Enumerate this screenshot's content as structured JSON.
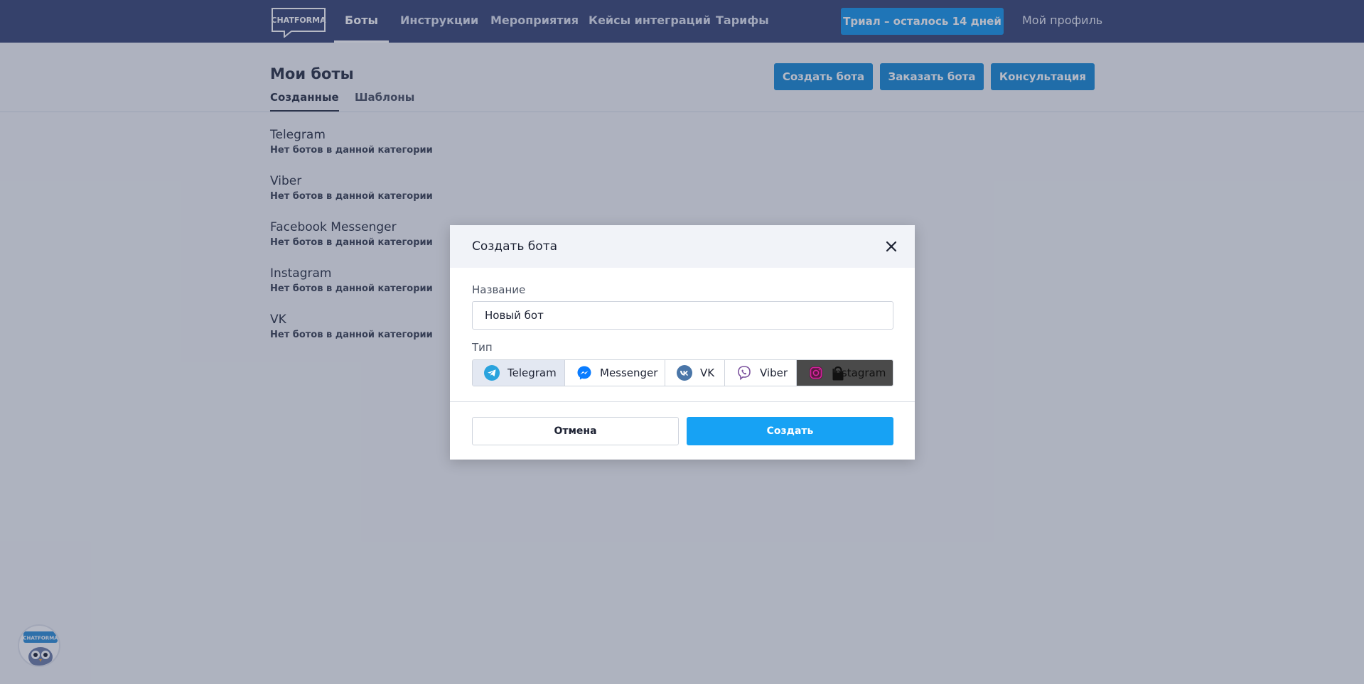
{
  "header": {
    "logo_text": "CHATFORMA",
    "nav": [
      {
        "label": "Боты",
        "active": true
      },
      {
        "label": "Инструкции"
      },
      {
        "label": "Мероприятия"
      },
      {
        "label": "Кейсы интеграций"
      },
      {
        "label": "Тарифы"
      }
    ],
    "trial_label": "Триал – осталось 14 дней",
    "profile_label": "Мой профиль"
  },
  "page": {
    "title": "Мои боты",
    "tabs": [
      {
        "label": "Созданные",
        "active": true
      },
      {
        "label": "Шаблоны"
      }
    ],
    "actions": {
      "create": "Создать бота",
      "order": "Заказать бота",
      "consult": "Консультация"
    },
    "categories": [
      {
        "name": "Telegram",
        "empty_text": "Нет ботов в данной категории"
      },
      {
        "name": "Viber",
        "empty_text": "Нет ботов в данной категории"
      },
      {
        "name": "Facebook Messenger",
        "empty_text": "Нет ботов в данной категории"
      },
      {
        "name": "Instagram",
        "empty_text": "Нет ботов в данной категории"
      },
      {
        "name": "VK",
        "empty_text": "Нет ботов в данной категории"
      }
    ]
  },
  "modal": {
    "title": "Создать бота",
    "name_label": "Название",
    "name_value": "Новый бот",
    "type_label": "Тип",
    "types": [
      {
        "label": "Telegram",
        "icon": "telegram-icon",
        "selected": true
      },
      {
        "label": "Messenger",
        "icon": "messenger-icon"
      },
      {
        "label": "VK",
        "icon": "vk-icon"
      },
      {
        "label": "Viber",
        "icon": "viber-icon"
      },
      {
        "label": "Instagram",
        "icon": "instagram-icon",
        "locked": true
      }
    ],
    "cancel_label": "Отмена",
    "create_label": "Создать"
  },
  "widget": {
    "label": "CHATFORMA"
  },
  "colors": {
    "topbar": "#3a4777",
    "accent": "#1a8bd6",
    "create_button": "#17a2f4",
    "telegram": "#2aa3dd",
    "messenger": "#0a7cff",
    "vk": "#4a76a8",
    "viber": "#7b519d",
    "instagram": "#d6249f"
  }
}
